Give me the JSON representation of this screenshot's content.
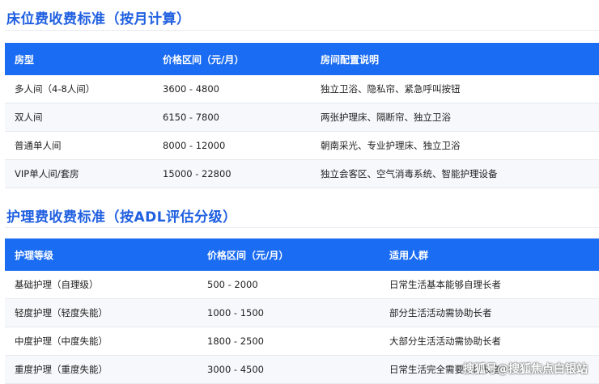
{
  "section1": {
    "title": "床位费收费标准（按月计算）",
    "headers": [
      "房型",
      "价格区间（元/月）",
      "房间配置说明"
    ],
    "rows": [
      [
        "多人间（4-8人间）",
        "3600 - 4800",
        "独立卫浴、隐私帘、紧急呼叫按钮"
      ],
      [
        "双人间",
        "6150 - 7800",
        "两张护理床、隔断帘、独立卫浴"
      ],
      [
        "普通单人间",
        "8000 - 12000",
        "朝南采光、专业护理床、独立卫浴"
      ],
      [
        "VIP单人间/套房",
        "15000 - 22800",
        "独立会客区、空气消毒系统、智能护理设备"
      ]
    ]
  },
  "section2": {
    "title": "护理费收费标准（按ADL评估分级）",
    "headers": [
      "护理等级",
      "价格区间（元/月）",
      "适用人群"
    ],
    "rows": [
      [
        "基础护理（自理级）",
        "500 - 2000",
        "日常生活基本能够自理长者"
      ],
      [
        "轻度护理（轻度失能）",
        "1000 - 1500",
        "部分生活活动需协助长者"
      ],
      [
        "中度护理（中度失能）",
        "1800 - 2500",
        "大部分生活活动需协助长者"
      ],
      [
        "重度护理（重度失能）",
        "3000 - 4500",
        "日常生活完全需要协助长者"
      ]
    ]
  },
  "watermark": "搜狐号@搜狐焦点白银站"
}
